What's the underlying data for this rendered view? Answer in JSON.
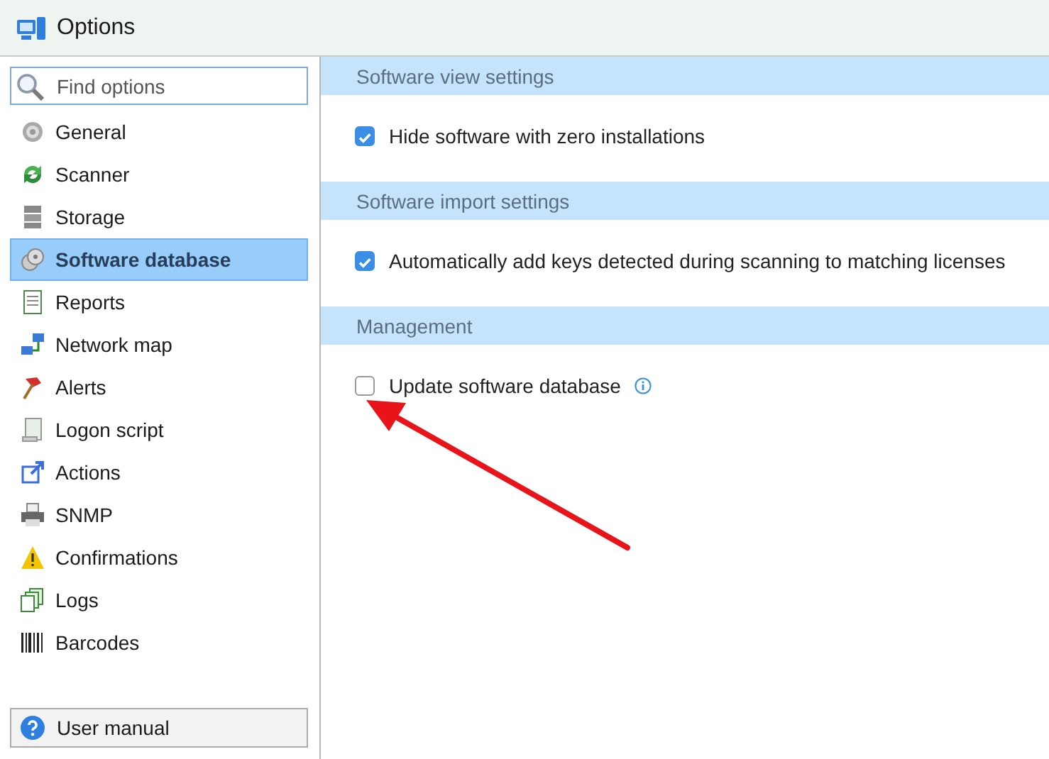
{
  "window": {
    "title": "Options"
  },
  "sidebar": {
    "search": {
      "placeholder": "Find options"
    },
    "items": [
      {
        "label": "General",
        "selected": false
      },
      {
        "label": "Scanner",
        "selected": false
      },
      {
        "label": "Storage",
        "selected": false
      },
      {
        "label": "Software database",
        "selected": true
      },
      {
        "label": "Reports",
        "selected": false
      },
      {
        "label": "Network map",
        "selected": false
      },
      {
        "label": "Alerts",
        "selected": false
      },
      {
        "label": "Logon script",
        "selected": false
      },
      {
        "label": "Actions",
        "selected": false
      },
      {
        "label": "SNMP",
        "selected": false
      },
      {
        "label": "Confirmations",
        "selected": false
      },
      {
        "label": "Logs",
        "selected": false
      },
      {
        "label": "Barcodes",
        "selected": false
      }
    ],
    "help_button": {
      "label": "User manual"
    }
  },
  "sections": [
    {
      "title": "Software view settings",
      "options": [
        {
          "label": "Hide software with zero installations",
          "checked": true
        }
      ]
    },
    {
      "title": "Software import settings",
      "options": [
        {
          "label": "Automatically add keys detected during scanning to matching licenses",
          "checked": true
        }
      ]
    },
    {
      "title": "Management",
      "options": [
        {
          "label": "Update software database",
          "checked": false,
          "info": true
        }
      ]
    }
  ],
  "annotation": {
    "kind": "arrow"
  }
}
